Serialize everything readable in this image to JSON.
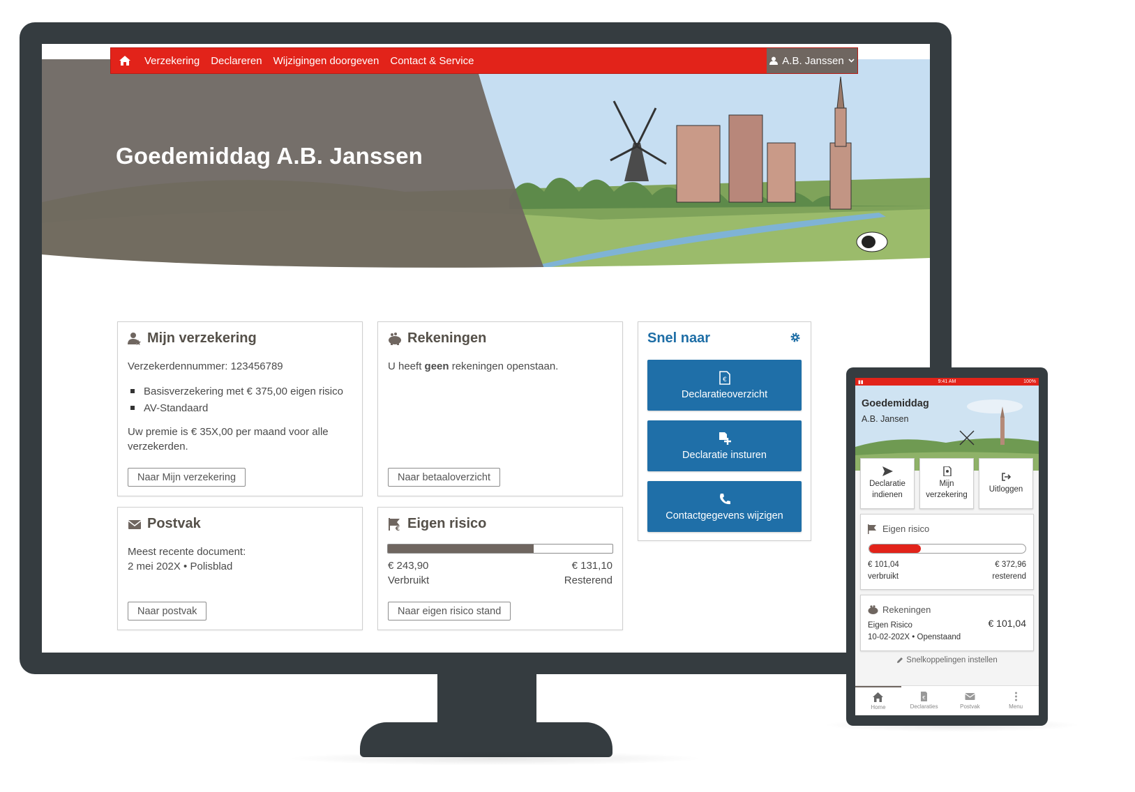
{
  "nav": {
    "items": [
      "Verzekering",
      "Declareren",
      "Wijzigingen doorgeven",
      "Contact & Service"
    ],
    "user": "A.B. Janssen"
  },
  "hero": {
    "greeting": "Goedemiddag A.B. Janssen"
  },
  "verzekering": {
    "title": "Mijn verzekering",
    "number_line": "Verzekerdennummer: 123456789",
    "items": [
      "Basisverzekering met € 375,00 eigen risico",
      "AV-Standaard"
    ],
    "premium": "Uw premie is € 35X,00 per maand voor alle verzekerden.",
    "button": "Naar Mijn verzekering"
  },
  "rekeningen": {
    "title": "Rekeningen",
    "text_pre": "U heeft ",
    "text_bold": "geen",
    "text_post": " rekeningen openstaan.",
    "button": "Naar betaaloverzicht"
  },
  "snel": {
    "title": "Snel naar",
    "buttons": [
      "Declaratieoverzicht",
      "Declaratie insturen",
      "Contactgegevens wijzigen"
    ]
  },
  "postvak": {
    "title": "Postvak",
    "line1": "Meest recente document:",
    "line2": "2 mei 202X • Polisblad",
    "button": "Naar postvak"
  },
  "eigen_risico": {
    "title": "Eigen risico",
    "used_fraction": 0.65,
    "used_amount": "€ 243,90",
    "remaining_amount": "€ 131,10",
    "used_label": "Verbruikt",
    "remaining_label": "Resterend",
    "button": "Naar eigen risico stand"
  },
  "phone": {
    "time": "9:41 AM",
    "battery": "100%",
    "greeting": "Goedemiddag",
    "name": "A.B. Jansen",
    "tiles": [
      {
        "line1": "Declaratie",
        "line2": "indienen"
      },
      {
        "line1": "Mijn",
        "line2": "verzekering"
      },
      {
        "line1": "Uitloggen",
        "line2": ""
      }
    ],
    "eigen_risico": {
      "title": "Eigen risico",
      "used_fraction": 0.33,
      "used_amount": "€ 101,04",
      "remaining_amount": "€ 372,96",
      "used_label": "verbruikt",
      "remaining_label": "resterend"
    },
    "rekeningen": {
      "title": "Rekeningen",
      "line1": "Eigen Risico",
      "line2": "10-02-202X • Openstaand",
      "amount": "€ 101,04"
    },
    "link": "Snelkoppelingen instellen",
    "tabs": [
      "Home",
      "Declaraties",
      "Postvak",
      "Menu"
    ]
  },
  "colors": {
    "brand_red": "#e2231a",
    "brand_blue": "#1f6fa8",
    "taupe": "#6f6660"
  }
}
